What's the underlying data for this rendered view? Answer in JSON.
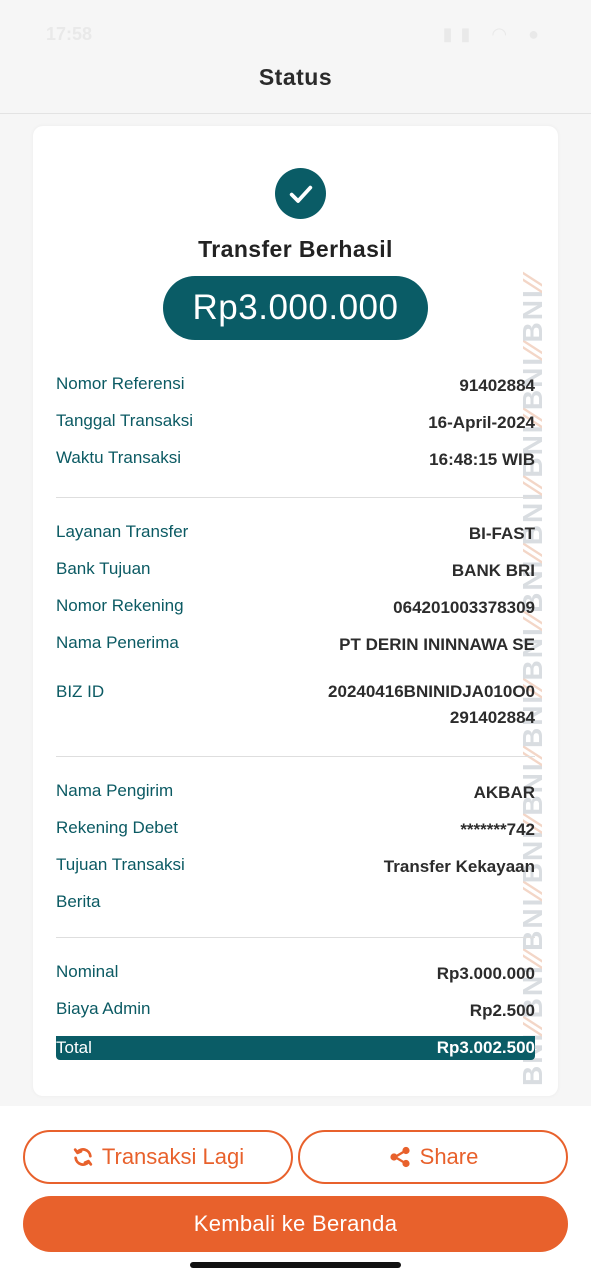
{
  "status_bar": {
    "time": "17:58",
    "icons": "▮▮ ◠ ●"
  },
  "header": {
    "title": "Status"
  },
  "receipt": {
    "success_title": "Transfer Berhasil",
    "amount": "Rp3.000.000",
    "watermark": "BNI",
    "section1": [
      {
        "label": "Nomor Referensi",
        "value": "91402884"
      },
      {
        "label": "Tanggal Transaksi",
        "value": "16-April-2024"
      },
      {
        "label": "Waktu Transaksi",
        "value": "16:48:15 WIB"
      }
    ],
    "section2": [
      {
        "label": "Layanan Transfer",
        "value": "BI-FAST"
      },
      {
        "label": "Bank Tujuan",
        "value": "BANK BRI"
      },
      {
        "label": "Nomor Rekening",
        "value": "064201003378309"
      },
      {
        "label": "Nama Penerima",
        "value": "PT DERIN ININNAWA SE"
      },
      {
        "label": "BIZ ID",
        "value_line1": "20240416BNINIDJA010O0",
        "value_line2": "291402884"
      }
    ],
    "section3": [
      {
        "label": "Nama Pengirim",
        "value": "AKBAR"
      },
      {
        "label": "Rekening Debet",
        "value": "*******742"
      },
      {
        "label": "Tujuan Transaksi",
        "value": "Transfer Kekayaan"
      },
      {
        "label": "Berita",
        "value": ""
      }
    ],
    "section4": [
      {
        "label": "Nominal",
        "value": "Rp3.000.000"
      },
      {
        "label": "Biaya Admin",
        "value": "Rp2.500"
      }
    ],
    "total": {
      "label": "Total",
      "value": "Rp3.002.500"
    }
  },
  "actions": {
    "again_label": "Transaksi Lagi",
    "share_label": "Share",
    "home_label": "Kembali ke Beranda"
  },
  "colors": {
    "primary": "#0a5c66",
    "accent": "#e8612c"
  }
}
